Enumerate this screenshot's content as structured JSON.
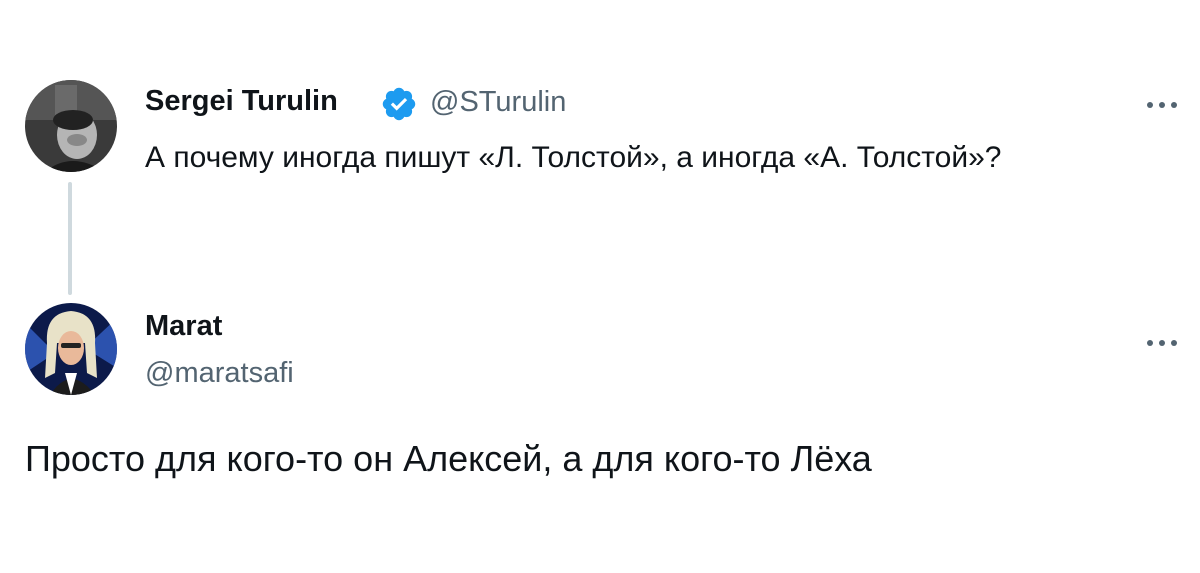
{
  "tweet": {
    "author_name": "Sergei Turulin",
    "author_handle": "@STurulin",
    "verified": true,
    "text": "А почему иногда пишут «Л. Толстой», а иногда «А. Толстой»?"
  },
  "reply": {
    "author_name": "Marat",
    "author_handle": "@maratsafi",
    "text": "Просто для кого-то он Алексей, а для кого-то Лёха"
  },
  "icons": {
    "verified": "verified-badge-icon",
    "more": "more-options-icon"
  },
  "colors": {
    "text_primary": "#0f1419",
    "text_secondary": "#536471",
    "verified_blue": "#1d9bf0",
    "thread_line": "#cfd9de",
    "background": "#ffffff"
  }
}
